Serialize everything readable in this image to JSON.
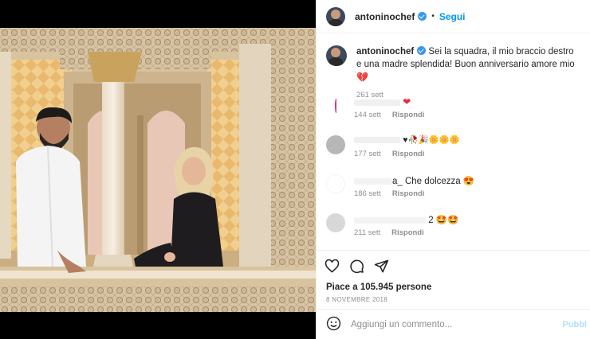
{
  "header": {
    "username": "antoninochef",
    "separator": "•",
    "follow_label": "Segui"
  },
  "caption": {
    "username": "antoninochef",
    "text": "Sei la squadra, il mio braccio destro e una madre splendida! Buon anniversario amore mio",
    "heart": "💔",
    "age": "261 sett"
  },
  "comments": [
    {
      "text_visible": "",
      "emojis": "❤",
      "age": "144 sett",
      "reply": "Rispondi"
    },
    {
      "text_visible": "",
      "emojis": "♥🥀🎉🌼🌼🌼",
      "age": "177 sett",
      "reply": "Rispondi"
    },
    {
      "text_visible": "a_ Che dolcezza",
      "emojis": "😍",
      "age": "186 sett",
      "reply": "Rispondi"
    },
    {
      "text_visible": "2",
      "emojis": "🤩🤩",
      "age": "211 sett",
      "reply": "Rispondi"
    }
  ],
  "footer": {
    "likes": "Piace a 105.945 persone",
    "date": "8 NOVEMBRE 2018",
    "comment_placeholder": "Aggiungi un commento...",
    "publish_label": "Pubbl"
  },
  "icons": [
    "heart-icon",
    "comment-icon",
    "share-icon",
    "emoji-icon"
  ],
  "colors": {
    "link": "#0095f6",
    "verified": "#3897f0",
    "muted": "#8e8e8e"
  }
}
